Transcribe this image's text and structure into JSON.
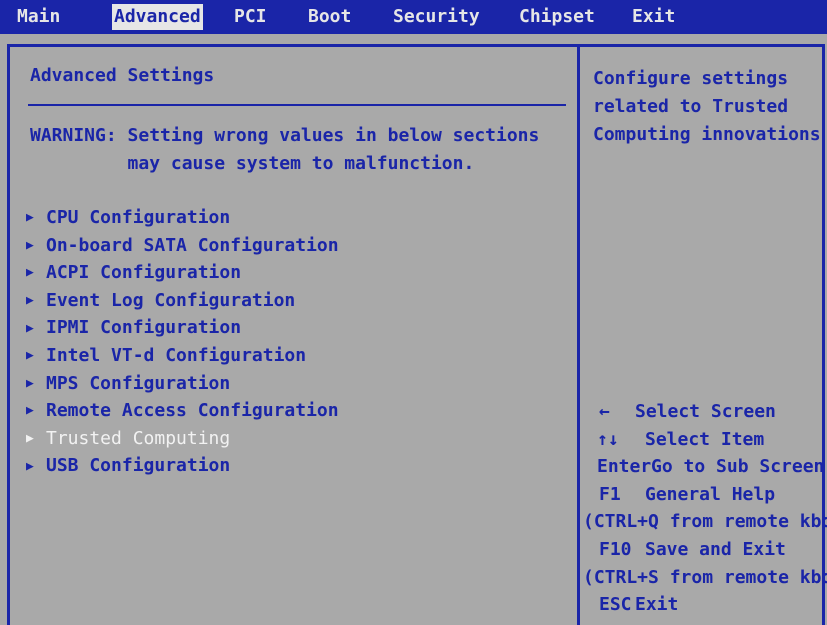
{
  "menu_tabs": [
    "Main",
    "Advanced",
    "PCI",
    "Boot",
    "Security",
    "Chipset",
    "Exit"
  ],
  "active_tab": "Advanced",
  "settings": {
    "title": "Advanced Settings",
    "warning_line1": "WARNING: Setting wrong values in below sections",
    "warning_line2": "         may cause system to malfunction.",
    "items": [
      "CPU Configuration",
      "On-board SATA Configuration",
      "ACPI Configuration",
      "Event Log Configuration",
      "IPMI Configuration",
      "Intel VT-d Configuration",
      "MPS Configuration",
      "Remote Access Configuration",
      "Trusted Computing",
      "USB Configuration"
    ],
    "selected_item": "Trusted Computing"
  },
  "help": {
    "text": "Configure settings\nrelated to Trusted\nComputing innovations"
  },
  "key_hints": [
    {
      "key": "←",
      "text": "Select Screen"
    },
    {
      "key": "↑↓",
      "text": "Select Item"
    },
    {
      "key": "Enter",
      "text": "Go to Sub Screen"
    },
    {
      "key": "F1",
      "text": "General Help"
    },
    {
      "key": "",
      "text": "(CTRL+Q from remote kbd)"
    },
    {
      "key": "F10",
      "text": "Save and Exit"
    },
    {
      "key": "",
      "text": "(CTRL+S from remote kbd)"
    },
    {
      "key": "ESC",
      "text": "Exit"
    }
  ],
  "colors": {
    "background": "#a9a9a9",
    "accent": "#1a25a8",
    "highlight_text": "#f2f2f2"
  }
}
